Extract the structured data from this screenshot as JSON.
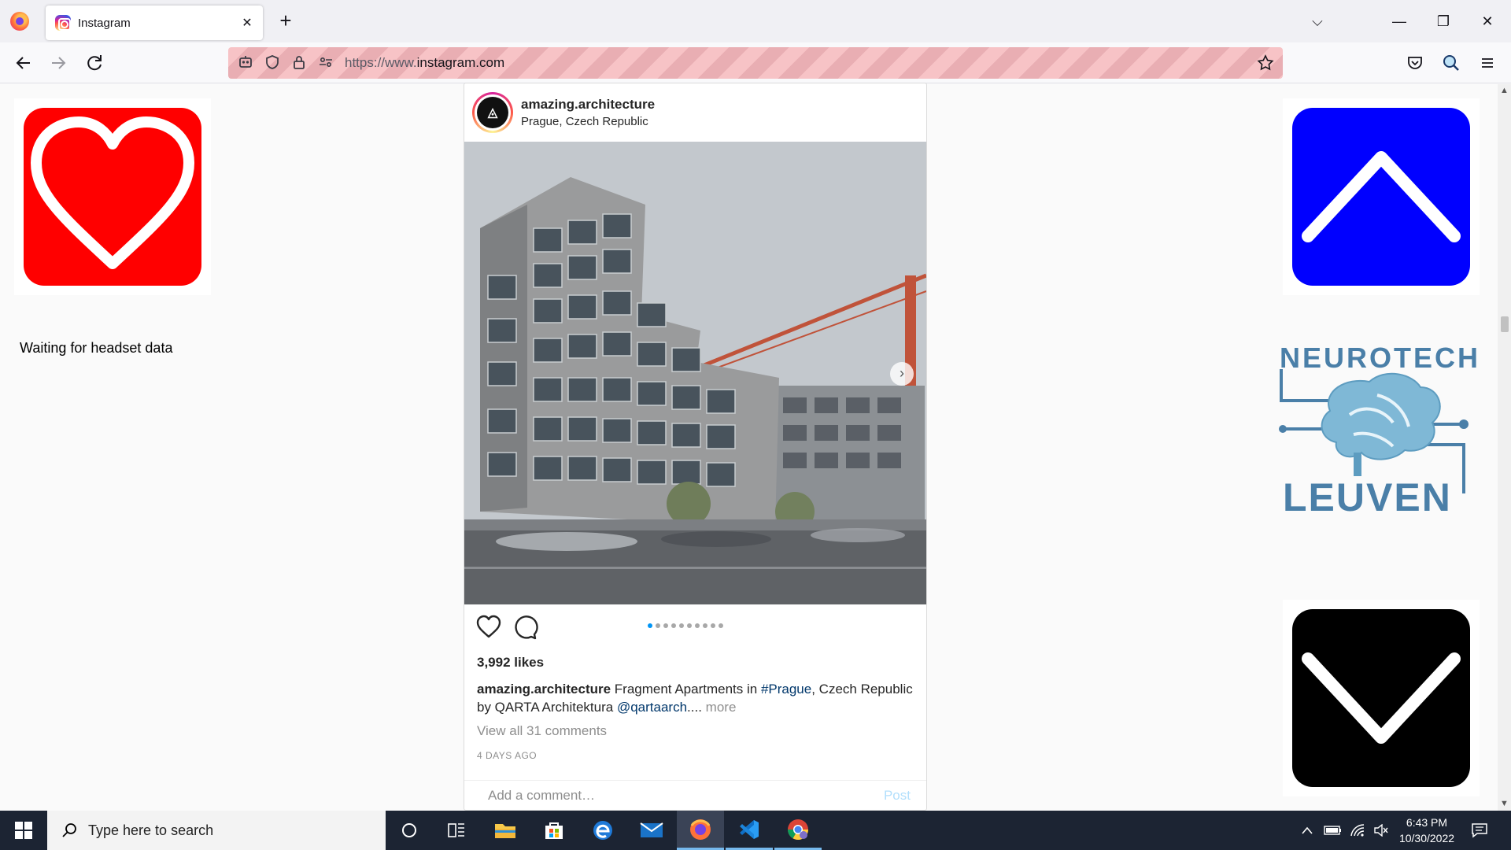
{
  "browser": {
    "tab_title": "Instagram",
    "tab_close": "✕",
    "new_tab": "+",
    "url_prefix": "https://www.",
    "url_domain": "instagram.com",
    "window_controls": {
      "list": "⌵",
      "minimize": "—",
      "restore": "❐",
      "close": "✕"
    }
  },
  "page": {
    "status_text": "Waiting for headset data",
    "logo": {
      "top_word": "NEUROTECH",
      "bottom_word": "LEUVEN"
    }
  },
  "post": {
    "username": "amazing.architecture",
    "location": "Prague, Czech Republic",
    "avatar_glyph": "◬",
    "likes": "3,992 likes",
    "caption_username": "amazing.architecture",
    "caption_part1": " Fragment Apartments in ",
    "caption_tag": "#Prague",
    "caption_part2": ", Czech Republic by QARTA Architektura ",
    "caption_mention": "@qartaarch",
    "caption_ellipsis": "....",
    "caption_more": " more",
    "view_comments": "View all 31 comments",
    "timestamp": "4 DAYS AGO",
    "comment_placeholder": "Add a comment…",
    "post_button": "Post",
    "carousel_count": 10,
    "carousel_active": 0
  },
  "taskbar": {
    "search_placeholder": "Type here to search",
    "time": "6:43 PM",
    "date": "10/30/2022"
  },
  "colors": {
    "heart_bg": "#ff0000",
    "up_bg": "#0000ff",
    "down_bg": "#000000",
    "neurotech_blue": "#4a7fa8"
  }
}
